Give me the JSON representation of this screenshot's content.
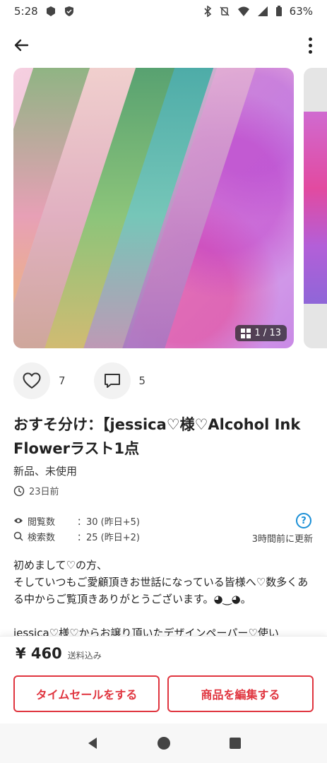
{
  "status_bar": {
    "time": "5:28",
    "battery": "63%"
  },
  "listing": {
    "image_counter": "1 / 13",
    "likes_count": "7",
    "comments_count": "5",
    "title": "おすそ分け：【jessica♡様♡Alcohol Ink Flowerラスト1点",
    "condition": "新品、未使用",
    "posted": "23日前",
    "views_label": "閲覧数",
    "views_value": "：30 (昨日+5)",
    "searches_label": "検索数",
    "searches_value": "：25 (昨日+2)",
    "help_mark": "?",
    "updated": "3時間前に更新",
    "description": "初めまして♡の方、\nそしていつもご愛顧頂きお世話になっている皆様へ♡数多くある中からご覧頂きありがとうございます。◕‿◕。\n\njessica♡様♡からお譲り頂いたデザインペーパー♡使い",
    "price": "¥ 460",
    "shipping": "送料込み"
  },
  "buttons": {
    "time_sale": "タイムセールをする",
    "edit": "商品を編集する"
  },
  "colors": {
    "accent": "#e0353f",
    "help": "#1a8fd6"
  }
}
